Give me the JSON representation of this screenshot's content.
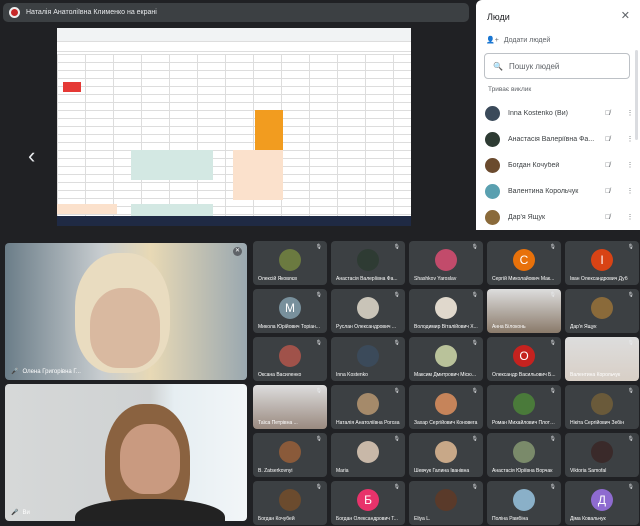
{
  "presenter_bar": {
    "text": "Наталія Анатоліївна Клименко на екрані"
  },
  "people_panel": {
    "title": "Люди",
    "close_icon": "close-icon",
    "add_label": "Додати людей",
    "search_placeholder": "Пошук людей",
    "section": "Триває виклик",
    "items": [
      {
        "name": "Inna Kostenko (Ви)",
        "color": "#3b4a5a"
      },
      {
        "name": "Анастасія Валеріївна Фа...",
        "color": "#2e3b33"
      },
      {
        "name": "Богдан Кочубей",
        "color": "#6b4b2e"
      },
      {
        "name": "Валентина Корольчук",
        "color": "#5aa0b0"
      },
      {
        "name": "Дар'я Ящук",
        "color": "#8a6a3a"
      }
    ]
  },
  "main_tiles": [
    {
      "name": "Олена Григорівна Г..."
    },
    {
      "name": "Ви"
    }
  ],
  "tiles": [
    {
      "name": "Олексій Яковлєв",
      "color": "#6b7a40",
      "letter": ""
    },
    {
      "name": "Анастасія Валеріївна Фа...",
      "color": "#2e3b33",
      "letter": ""
    },
    {
      "name": "Shashkov Yaroslav",
      "color": "#c24b6b",
      "letter": ""
    },
    {
      "name": "Сергій Миколайович Мак...",
      "color": "#e8710a",
      "letter": "С"
    },
    {
      "name": "Іван Олександрович Дуб",
      "color": "#d84315",
      "letter": "І"
    },
    {
      "name": "Микола Юрійович Торіан...",
      "color": "#78909c",
      "letter": "М"
    },
    {
      "name": "Руслан Олександрович ...",
      "color": "#c9c4b8",
      "letter": ""
    },
    {
      "name": "Володимир Віталійович Х...",
      "color": "#e0d8cc",
      "letter": ""
    },
    {
      "name": "Анна Білоконь",
      "color": "#8a7a6a",
      "letter": "",
      "video": true
    },
    {
      "name": "Дар'я Ящук",
      "color": "#8a6a3a",
      "letter": ""
    },
    {
      "name": "Оксана Василенко",
      "color": "#a0524a",
      "letter": ""
    },
    {
      "name": "Inna Kostenko",
      "color": "#3b4a5a",
      "letter": ""
    },
    {
      "name": "Максим Дмитрович Місю...",
      "color": "#b9c29a",
      "letter": ""
    },
    {
      "name": "Олександр Васильович Б...",
      "color": "#c5221f",
      "letter": "О"
    },
    {
      "name": "Валентина Корольчук",
      "color": "#d8cfc6",
      "letter": "",
      "video": true
    },
    {
      "name": "Таїса Петрівна ...",
      "color": "#9a8a80",
      "letter": "",
      "video": true
    },
    {
      "name": "Наталія Анатоліївна Рогоза",
      "color": "#a58a6a",
      "letter": ""
    },
    {
      "name": "Захар Сергійович Коновега",
      "color": "#c6845a",
      "letter": ""
    },
    {
      "name": "Роман Михайлович Плотков",
      "color": "#4a7a3a",
      "letter": ""
    },
    {
      "name": "Нікіта Сергійович Зебін",
      "color": "#6a5a3a",
      "letter": ""
    },
    {
      "name": "B. Zatserkovnyi",
      "color": "#8a5a3a",
      "letter": ""
    },
    {
      "name": "Maria",
      "color": "#c8b8a8",
      "letter": ""
    },
    {
      "name": "Шевчук Галина Іванівна",
      "color": "#c8a888",
      "letter": ""
    },
    {
      "name": "Анастасія Юріївна Ворчак",
      "color": "#7a8a6a",
      "letter": ""
    },
    {
      "name": "Viktoria Samofal",
      "color": "#3a2a2a",
      "letter": ""
    },
    {
      "name": "Богдан Кочубей",
      "color": "#6b4b2e",
      "letter": ""
    },
    {
      "name": "Богдан Олександрович Т...",
      "color": "#e8336b",
      "letter": "Б"
    },
    {
      "name": "Eliya L.",
      "color": "#5a3a2a",
      "letter": ""
    },
    {
      "name": "Поліна Рамбіна",
      "color": "#8ab0c8",
      "letter": ""
    },
    {
      "name": "Діма Ковальчук",
      "color": "#8e6bd0",
      "letter": "Д"
    }
  ]
}
